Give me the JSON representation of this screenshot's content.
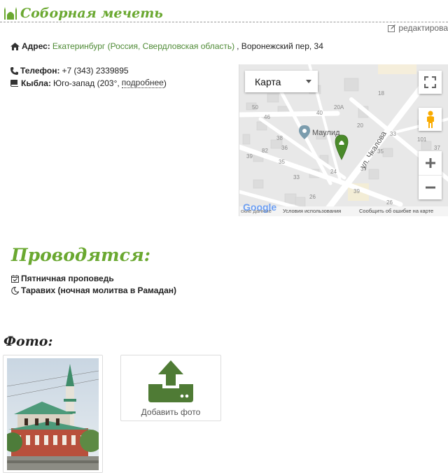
{
  "title": "Соборная мечеть",
  "edit_label": "редактирова",
  "address": {
    "label": "Адрес:",
    "city_link": "Екатеринбург (Россия, Свердловская область)",
    "street": ", Воронежский пер, 34"
  },
  "phone": {
    "label": "Телефон:",
    "value": "+7 (343) 2339895"
  },
  "qibla": {
    "label": "Кыбла:",
    "value": "Юго-запад (203°,",
    "details_link": "подробнее",
    "close": ")"
  },
  "map": {
    "type_label": "Карта",
    "place_label": "Маулид",
    "street_label": "ул. Чкалова",
    "google": "Google",
    "footer_left": "ские данные",
    "terms": "Условия использования",
    "report": "Сообщить об ошибке на карте",
    "house_numbers": [
      "50",
      "46",
      "40",
      "20A",
      "18",
      "31",
      "38",
      "36",
      "20",
      "33",
      "101",
      "37",
      "82",
      "39",
      "35",
      "39",
      "33",
      "24",
      "37",
      "35",
      "26",
      "39",
      "26"
    ]
  },
  "events": {
    "heading": "Проводятся:",
    "items": [
      "Пятничная проповедь",
      "Таравих (ночная молитва в Рамадан)"
    ]
  },
  "photos": {
    "heading": "Фото:",
    "add_label": "Добавить фото"
  },
  "colors": {
    "accent": "#6aa830",
    "link": "#4e8a35",
    "upload": "#4f7b35"
  }
}
